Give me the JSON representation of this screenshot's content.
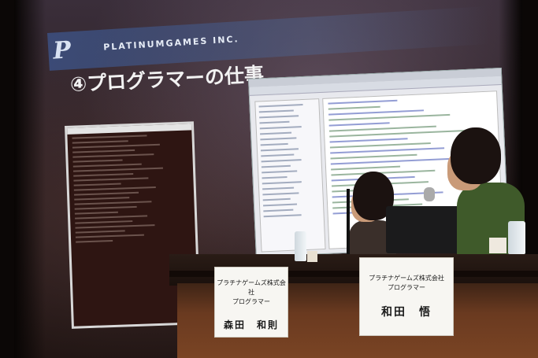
{
  "slide": {
    "logo_mark": "P",
    "logo_text": "PLATINUMGAMES INC.",
    "title": "④プログラマーの仕事"
  },
  "name_cards": [
    {
      "company": "プラチナゲームズ株式会社",
      "role": "プログラマー",
      "name": "森田　和則"
    },
    {
      "company": "プラチナゲームズ株式会社",
      "role": "プログラマー",
      "name": "和田　悟"
    }
  ],
  "colors": {
    "screen": "#2a1d1d",
    "logo_band": "#3c5082",
    "table_front": "#6a3a20",
    "shirt_green": "#3f5a2a"
  }
}
